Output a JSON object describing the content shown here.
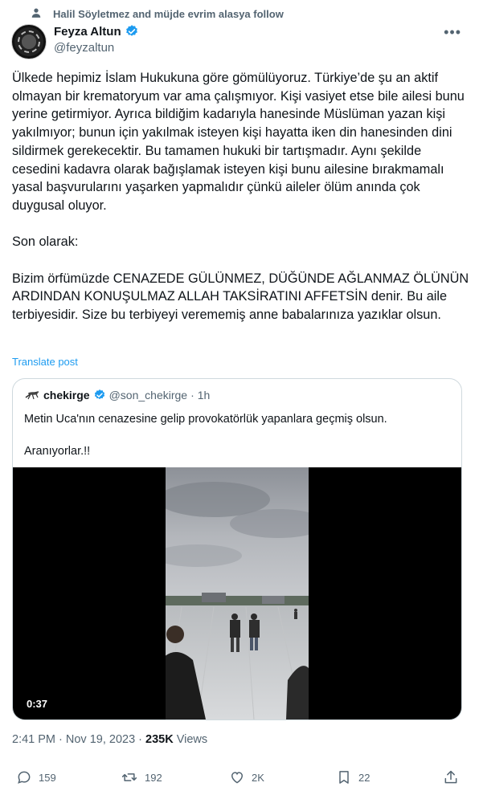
{
  "social_context": "Halil Söyletmez and müjde evrim alasya follow",
  "author": {
    "name": "Feyza Altun",
    "handle": "@feyzaltun"
  },
  "more_icon": "more-icon",
  "tweet_text": "Ülkede hepimiz İslam Hukukuna göre gömülüyoruz. Türkiye’de şu an aktif olmayan bir krematoryum var ama çalışmıyor. Kişi vasiyet etse bile ailesi bunu yerine getirmiyor. Ayrıca bildiğim kadarıyla hanesinde Müslüman yazan kişi yakılmıyor; bunun için yakılmak isteyen kişi hayatta iken din hanesinden dini sildirmek gerekecektir. Bu tamamen hukuki bir tartışmadır.  Aynı şekilde cesedini kadavra olarak bağışlamak isteyen kişi bunu ailesine bırakmamalı yasal başvurularını yaşarken yapmalıdır çünkü aileler ölüm anında çok duygusal oluyor.\n\nSon olarak:\n\nBizim örfümüzde CENAZEDE GÜLÜNMEZ, DÜĞÜNDE AĞLANMAZ ÖLÜNÜN ARDINDAN KONUŞULMAZ ALLAH TAKSİRATINI AFFETSİN denir. Bu aile terbiyesidir. Size bu terbiyeyi verememiş anne babalarınıza yazıklar olsun.",
  "translate_label": "Translate post",
  "quote": {
    "name": "chekirge",
    "handle": "@son_chekirge",
    "separator": "·",
    "time": "1h",
    "text": "Metin Uca'nın cenazesine gelip provokatörlük yapanlara geçmiş olsun.\n\nAranıyorlar.!!",
    "video_duration": "0:37"
  },
  "meta": {
    "time": "2:41 PM · Nov 19, 2023 · ",
    "views_count": "235K",
    "views_label": " Views"
  },
  "actions": {
    "replies": "159",
    "reposts": "192",
    "likes": "2K",
    "bookmarks": "22"
  },
  "colors": {
    "accent": "#1d9bf0",
    "secondary_text": "#536471",
    "border": "#cfd9de"
  }
}
